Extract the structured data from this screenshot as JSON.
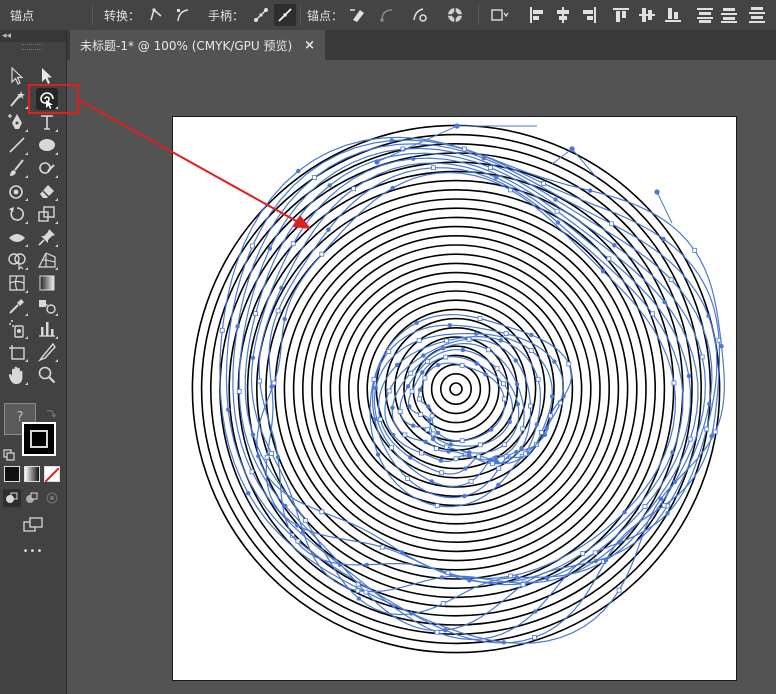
{
  "control_bar": {
    "tool_name": "锚点",
    "convert_label": "转换：",
    "handles_label": "手柄：",
    "anchors_label": "锚点：",
    "buttons": [
      "convert-to-corner",
      "convert-to-smooth",
      "show-handles",
      "hide-handles",
      "remove-anchor",
      "connect-anchors",
      "cut-path",
      "isolate",
      "transform",
      "align-left",
      "align-h-center",
      "align-right",
      "align-top",
      "align-v-center",
      "align-bottom",
      "distribute-top",
      "distribute-v-center",
      "distribute-bottom"
    ]
  },
  "tools_panel": {
    "collapse_glyph": "◂◂",
    "selected_tool": "twirl-tool",
    "fill_stroke_question": "?",
    "more_tools_glyph": "•••"
  },
  "document_tab": {
    "title": "未标题-1* @ 100% (CMYK/GPU 预览)",
    "close_glyph": "×"
  },
  "colors": {
    "ui_bg": "#535353",
    "panel_bg": "#424242",
    "path_black": "#000000",
    "selection_blue": "#4a78d6",
    "callout_red": "#e01e1e",
    "artboard": "#ffffff"
  }
}
